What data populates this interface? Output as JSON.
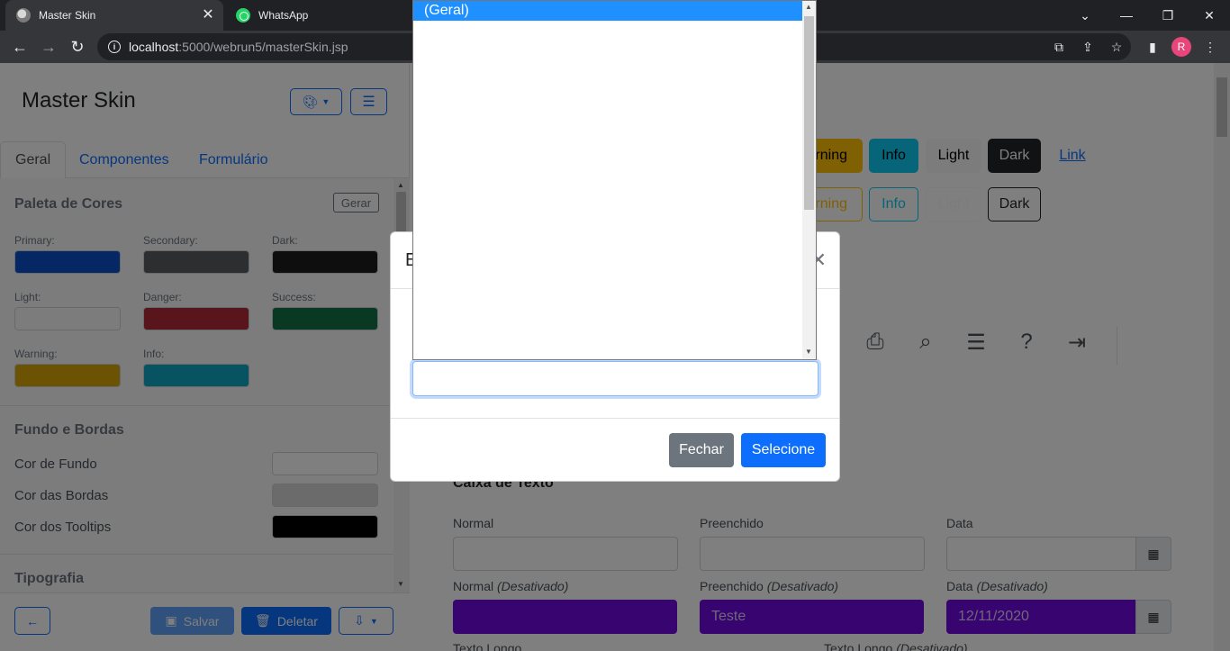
{
  "browser": {
    "tabs": [
      {
        "title": "Master Skin",
        "active": true
      },
      {
        "title": "WhatsApp",
        "active": false
      }
    ],
    "url_host": "localhost",
    "url_path": ":5000/webrun5/masterSkin.jsp",
    "profile_initial": "R"
  },
  "sidebar": {
    "title": "Master Skin",
    "tabs": [
      "Geral",
      "Componentes",
      "Formulário"
    ],
    "palette": {
      "title": "Paleta de Cores",
      "generate_label": "Gerar",
      "swatches": [
        {
          "label": "Primary:",
          "color": "#0a50c9"
        },
        {
          "label": "Secondary:",
          "color": "#585c61"
        },
        {
          "label": "Dark:",
          "color": "#1c1d1f"
        },
        {
          "label": "Light:",
          "color": "#f8f9fa"
        },
        {
          "label": "Danger:",
          "color": "#b02a37"
        },
        {
          "label": "Success:",
          "color": "#157347"
        },
        {
          "label": "Warning:",
          "color": "#d9a406"
        },
        {
          "label": "Info:",
          "color": "#0fa7c2"
        }
      ]
    },
    "background": {
      "title": "Fundo e Bordas",
      "rows": [
        {
          "label": "Cor de Fundo",
          "color": "#ffffff"
        },
        {
          "label": "Cor das Bordas",
          "color": "#d6d6d6"
        },
        {
          "label": "Cor dos Tooltips",
          "color": "#000000"
        }
      ]
    },
    "typography_title": "Tipografia",
    "footer": {
      "save_label": "Salvar",
      "delete_label": "Deletar"
    }
  },
  "main": {
    "buttons_row1": [
      {
        "label": "Warning",
        "bg": "#ffc107",
        "fg": "#000"
      },
      {
        "label": "Info",
        "bg": "#0dcaf0",
        "fg": "#000"
      },
      {
        "label": "Light",
        "bg": "#f8f9fa",
        "fg": "#000"
      },
      {
        "label": "Dark",
        "bg": "#212529",
        "fg": "#fff"
      },
      {
        "label": "Link"
      }
    ],
    "buttons_row2": [
      {
        "label": "Warning",
        "color": "#ffc107"
      },
      {
        "label": "Info",
        "color": "#0dcaf0"
      },
      {
        "label": "Light",
        "color": "#f8f9fa"
      },
      {
        "label": "Dark",
        "color": "#212529"
      }
    ],
    "textbox_title": "Caixa de Texto",
    "fields": [
      {
        "label": "Normal",
        "value": ""
      },
      {
        "label": "Preenchido",
        "value": ""
      },
      {
        "label": "Data",
        "value": ""
      }
    ],
    "fields_disabled": [
      {
        "label": "Normal",
        "suffix": "(Desativado)",
        "value": ""
      },
      {
        "label": "Preenchido",
        "suffix": "(Desativado)",
        "value": "Teste"
      },
      {
        "label": "Data",
        "suffix": "(Desativado)",
        "value": "12/11/2020"
      }
    ],
    "long_text_label": "Texto Longo",
    "long_text_disabled_label": "Texto Longo",
    "long_text_disabled_suffix": "(Desativado)"
  },
  "modal": {
    "title": "E",
    "close_label": "Fechar",
    "select_label": "Selecione",
    "options": [
      "(Geral)"
    ],
    "selected_option": "(Geral)"
  }
}
